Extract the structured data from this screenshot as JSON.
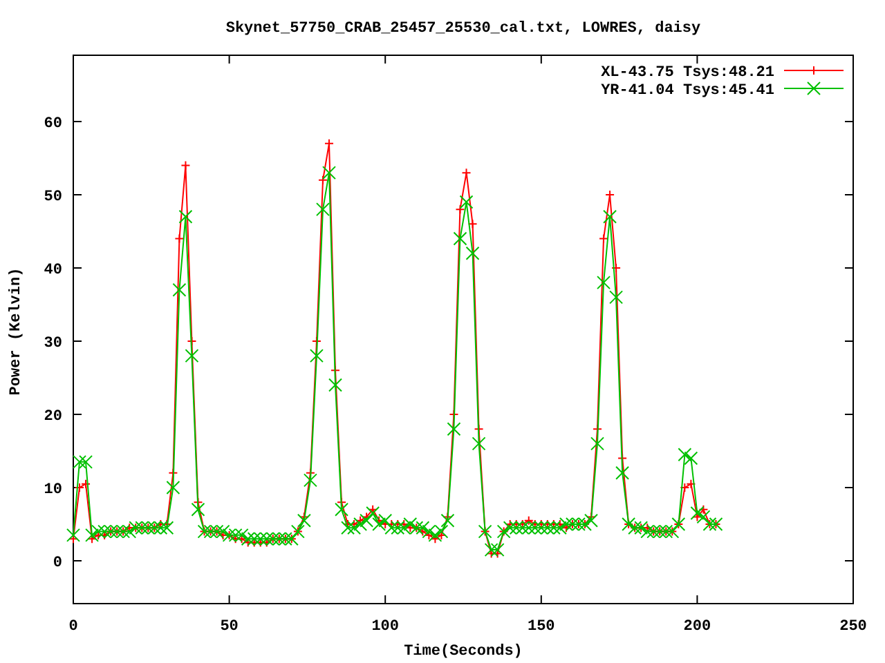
{
  "chart_data": {
    "type": "line",
    "title": "Skynet_57750_CRAB_25457_25530_cal.txt, LOWRES, daisy",
    "xlabel": "Time(Seconds)",
    "ylabel": "Power (Kelvin)",
    "x": [
      0,
      2,
      4,
      6,
      8,
      10,
      12,
      14,
      16,
      18,
      20,
      22,
      24,
      26,
      28,
      30,
      32,
      34,
      36,
      38,
      40,
      42,
      44,
      46,
      48,
      50,
      52,
      54,
      56,
      58,
      60,
      62,
      64,
      66,
      68,
      70,
      72,
      74,
      76,
      78,
      80,
      82,
      84,
      86,
      88,
      90,
      92,
      94,
      96,
      98,
      100,
      102,
      104,
      106,
      108,
      110,
      112,
      114,
      116,
      118,
      120,
      122,
      124,
      126,
      128,
      130,
      132,
      134,
      136,
      138,
      140,
      142,
      144,
      146,
      148,
      150,
      152,
      154,
      156,
      158,
      160,
      162,
      164,
      166,
      168,
      170,
      172,
      174,
      176,
      178,
      180,
      182,
      184,
      186,
      188,
      190,
      192,
      194,
      196,
      198,
      200,
      202,
      204,
      206
    ],
    "series": [
      {
        "name": "XL-43.75 Tsys:48.21",
        "color": "#ff0000",
        "marker": "plus",
        "values": [
          3,
          10,
          10.5,
          3,
          3.5,
          3.5,
          4,
          4,
          4,
          4.5,
          4.5,
          4.5,
          4.5,
          4.5,
          5,
          5,
          12,
          44,
          54,
          30,
          8,
          4,
          4,
          4,
          3.5,
          3.5,
          3,
          3,
          2.5,
          2.5,
          2.5,
          2.5,
          3,
          3,
          3,
          3,
          4,
          6,
          12,
          30,
          52,
          57,
          26,
          8,
          5,
          5,
          5.5,
          6,
          7,
          5.5,
          5,
          5,
          5,
          5,
          4.5,
          4.5,
          4,
          3.5,
          3,
          3.5,
          6,
          20,
          48,
          53,
          46,
          18,
          4,
          1,
          1,
          4,
          5,
          5,
          5,
          5.5,
          5,
          5,
          5,
          5,
          5,
          4.5,
          5,
          5,
          5,
          6,
          18,
          44,
          50,
          40,
          14,
          5,
          4.5,
          4.5,
          4.5,
          4,
          4,
          4,
          4,
          5,
          10,
          10.5,
          6,
          7,
          5,
          5
        ]
      },
      {
        "name": "YR-41.04 Tsys:45.41",
        "color": "#00c000",
        "marker": "cross",
        "values": [
          3.5,
          13.5,
          13.5,
          3.5,
          4,
          4,
          4,
          4,
          4,
          4,
          4.5,
          4.5,
          4.5,
          4.5,
          4.5,
          4.5,
          10,
          37,
          47,
          28,
          7,
          4,
          4,
          4,
          4,
          3.5,
          3.5,
          3.5,
          3,
          3,
          3,
          3,
          3,
          3,
          3,
          3,
          4,
          5.5,
          11,
          28,
          48,
          53,
          24,
          7,
          4.5,
          4.5,
          5,
          5.5,
          6.5,
          5,
          5.5,
          4.5,
          4.5,
          4.5,
          5,
          4.5,
          4.5,
          4,
          3.5,
          4,
          5.5,
          18,
          44,
          49,
          42,
          16,
          4,
          1.5,
          1.5,
          4,
          4.5,
          4.5,
          4.5,
          4.5,
          4.5,
          4.5,
          4.5,
          4.5,
          4.5,
          5,
          5,
          5,
          5,
          5.5,
          16,
          38,
          47,
          36,
          12,
          5,
          4.5,
          4.5,
          4,
          4,
          4,
          4,
          4,
          5,
          14.5,
          14,
          6.5,
          6,
          5,
          5
        ]
      }
    ],
    "legend": true,
    "xlim": [
      0,
      250
    ],
    "ylim": [
      -5.85,
      69.05
    ],
    "xticks": [
      0,
      50,
      100,
      150,
      200,
      250
    ],
    "yticks": [
      0,
      10,
      20,
      30,
      40,
      50,
      60
    ]
  }
}
